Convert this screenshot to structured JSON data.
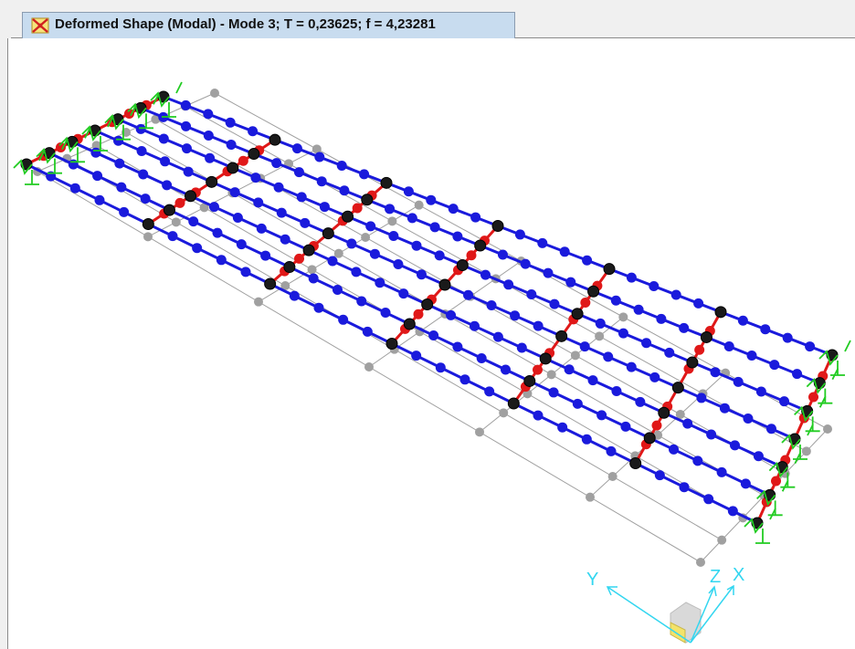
{
  "window": {
    "tab_title": "Deformed Shape (Modal) - Mode 3; T = 0,23625;  f = 4,23281",
    "tab_icon": "modal-shape-icon"
  },
  "axes": {
    "x_label": "X",
    "y_label": "Y",
    "z_label": "Z"
  },
  "colors": {
    "beam_longitudinal": "#1a1adc",
    "beam_transverse": "#e01818",
    "undeformed": "#a0a0a0",
    "node": "#1a1a1a",
    "restraint": "#22cc22",
    "axis": "#33d6f0"
  }
}
